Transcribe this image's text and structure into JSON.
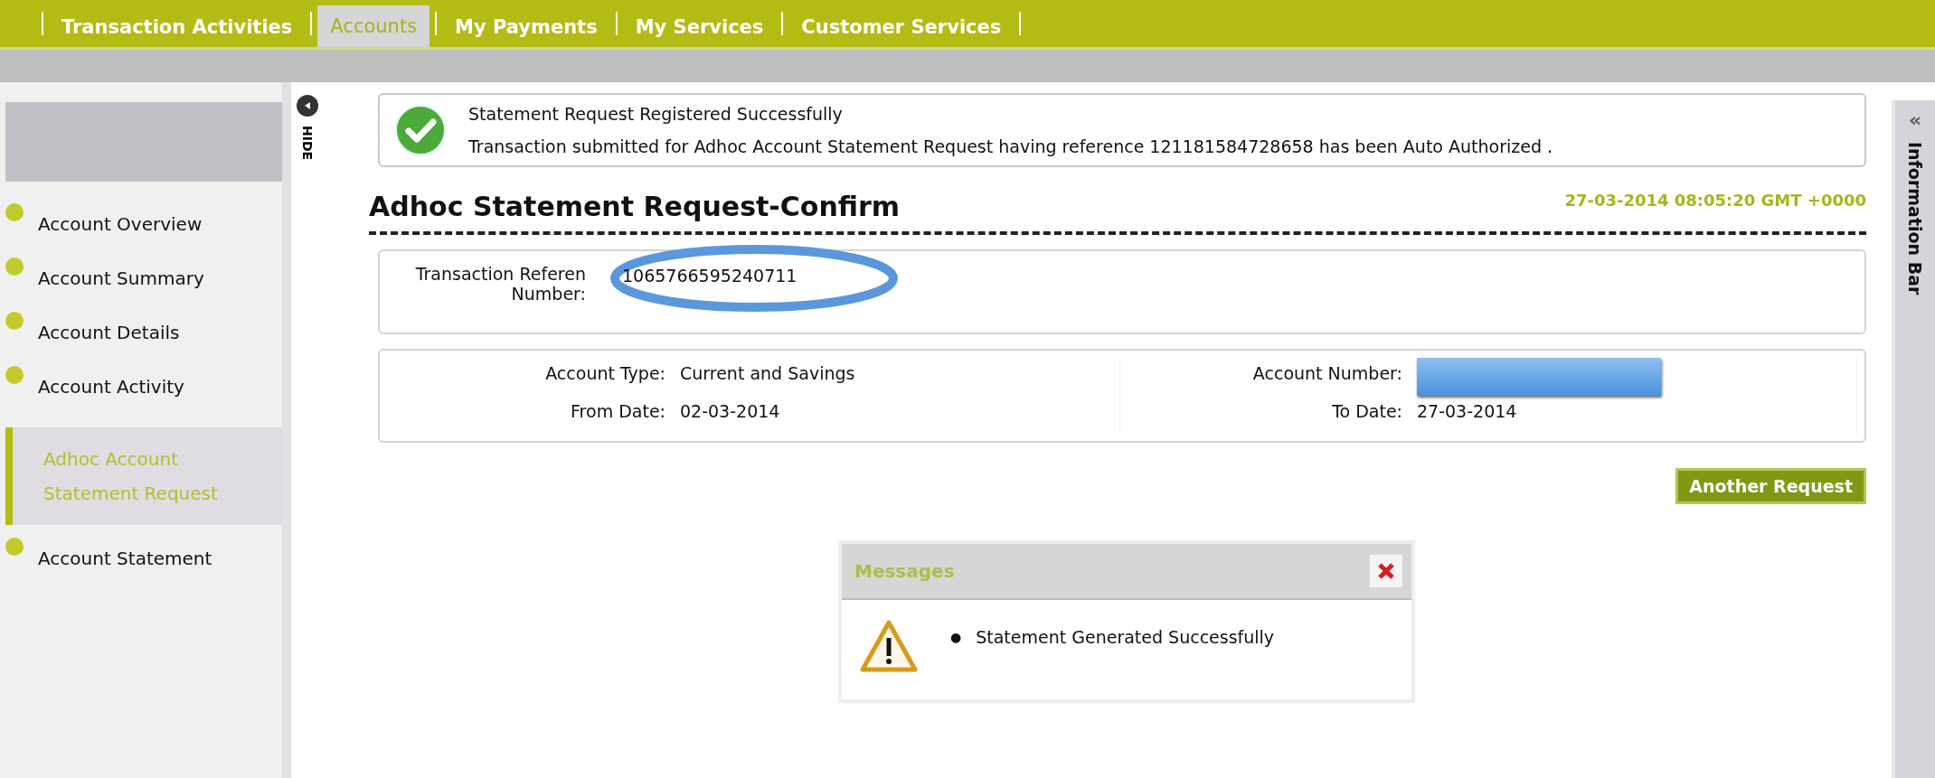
{
  "tabs": [
    {
      "label": "Transaction Activities",
      "selected": false
    },
    {
      "label": "Accounts",
      "selected": true
    },
    {
      "label": "My Payments",
      "selected": false
    },
    {
      "label": "My Services",
      "selected": false
    },
    {
      "label": "Customer Services",
      "selected": false
    }
  ],
  "sidebar": {
    "items": [
      {
        "label": "Account Overview",
        "selected": false
      },
      {
        "label": "Account Summary",
        "selected": false
      },
      {
        "label": "Account Details",
        "selected": false
      },
      {
        "label": "Account Activity",
        "selected": false
      },
      {
        "label": "Adhoc Account Statement Request",
        "selected": true
      },
      {
        "label": "Account Statement",
        "selected": false
      }
    ],
    "hide_label": "HIDE"
  },
  "success": {
    "title": "Statement Request Registered Successfully",
    "text": "Transaction submitted for Adhoc Account Statement Request having reference 121181584728658 has been Auto Authorized ."
  },
  "page_title": "Adhoc Statement Request-Confirm",
  "timestamp": "27-03-2014 08:05:20 GMT +0000",
  "reference": {
    "label": "Transaction Referen",
    "label_line_2": "Number:",
    "value": "1065766595240711",
    "circled": true
  },
  "details": [
    {
      "label": "Account Type:",
      "value": "Current and Savings",
      "kind": "text"
    },
    {
      "label": "Account Number:",
      "kind": "redacted"
    },
    {
      "label": "From Date:",
      "value": "02-03-2014",
      "kind": "text"
    },
    {
      "label": "To Date:",
      "value": "27-03-2014",
      "kind": "text"
    }
  ],
  "button": "Another Request",
  "messages": {
    "title": "Messages",
    "bullet": "●",
    "items": [
      "Statement Generated Successfully"
    ]
  },
  "info_bar": {
    "label": "Information Bar",
    "toggle": "«"
  }
}
